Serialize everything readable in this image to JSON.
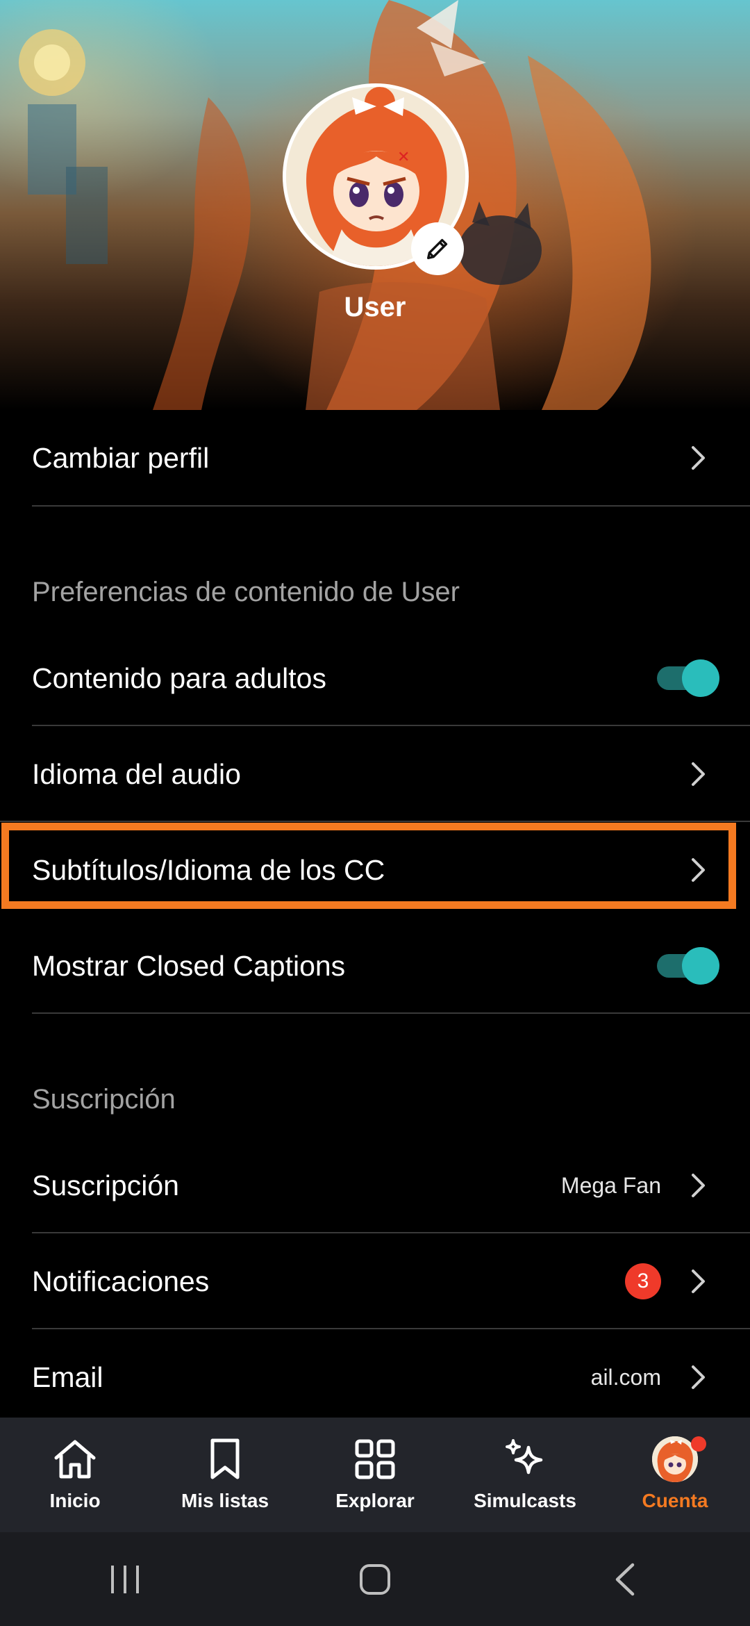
{
  "colors": {
    "accent": "#f47a21",
    "toggle_on": "#2abdbb",
    "badge": "#ef3a2a",
    "background": "#000000",
    "nav_background": "#23252b"
  },
  "profile": {
    "username": "User"
  },
  "rows": {
    "change_profile": "Cambiar perfil",
    "adult_content": "Contenido para adultos",
    "audio_language": "Idioma del audio",
    "subtitles_language": "Subtítulos/Idioma de los CC",
    "show_closed_captions": "Mostrar Closed Captions",
    "subscription": "Suscripción",
    "subscription_value": "Mega Fan",
    "notifications": "Notificaciones",
    "notifications_count": "3",
    "email": "Email",
    "email_value": "ail.com"
  },
  "toggles": {
    "adult_content_on": true,
    "show_closed_captions_on": true
  },
  "sections": {
    "content_preferences": "Preferencias de contenido de User",
    "subscription": "Suscripción"
  },
  "bottom_nav": {
    "home": "Inicio",
    "my_lists": "Mis listas",
    "browse": "Explorar",
    "simulcasts": "Simulcasts",
    "account": "Cuenta",
    "active": "account"
  },
  "icons": {
    "edit": "pencil-icon",
    "row_arrow": "chevron-right-icon",
    "home": "home-icon",
    "my_lists": "bookmark-icon",
    "browse": "grid-icon",
    "simulcasts": "sparkles-icon",
    "account": "avatar-icon",
    "recents": "recents-icon",
    "system_home": "home-square-icon",
    "back": "back-icon"
  }
}
